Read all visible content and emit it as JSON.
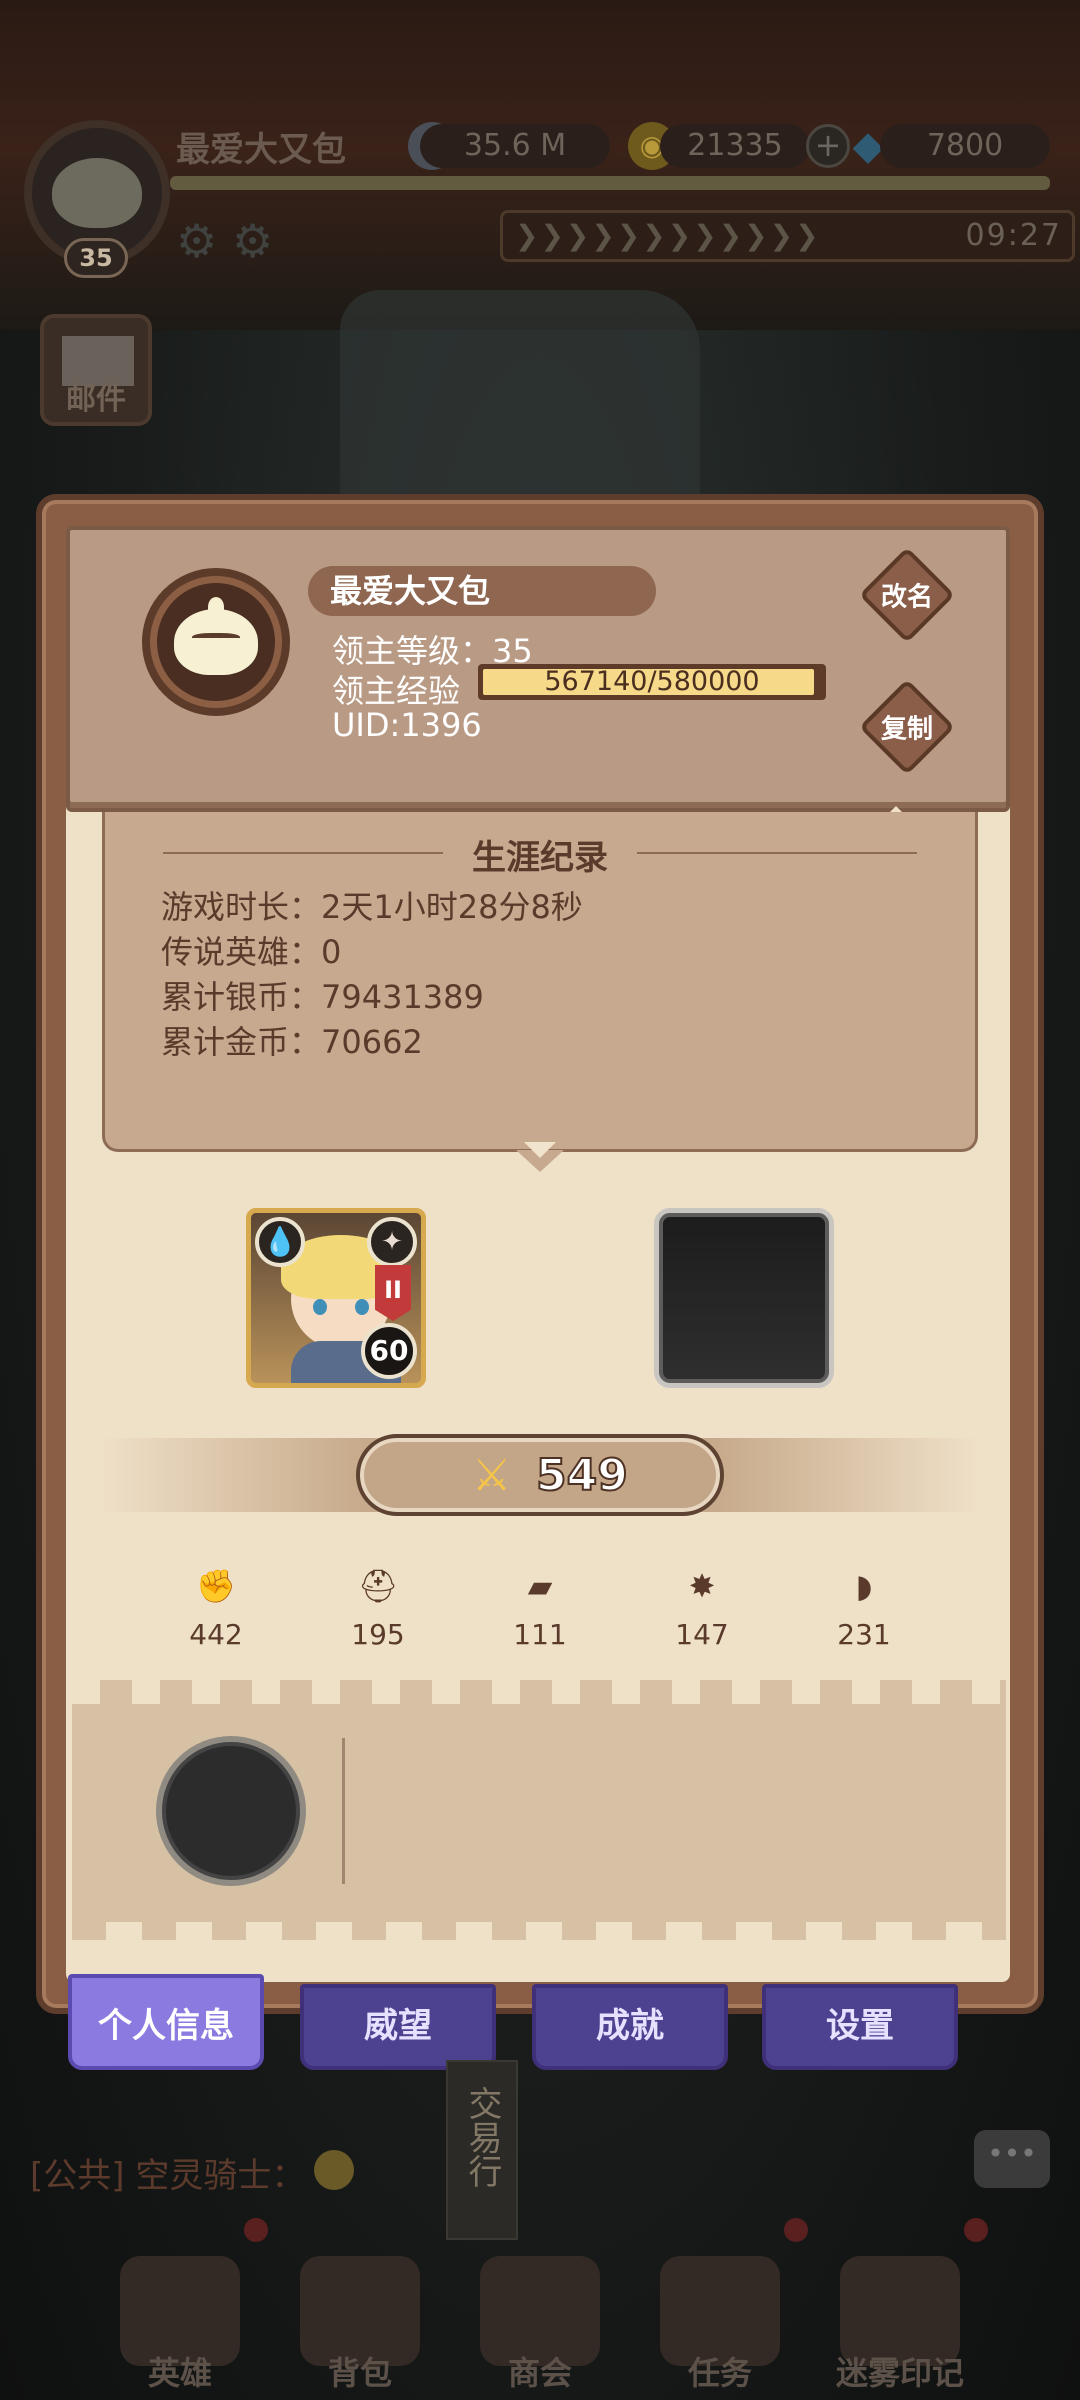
{
  "topbar": {
    "player_name": "最爱大又包",
    "player_level": "35",
    "silver": "35.6 M",
    "gold": "21335",
    "diamonds": "7800",
    "energy_timer": "09:27",
    "mail_label": "邮件"
  },
  "profile": {
    "name": "最爱大又包",
    "level_line": "领主等级：35",
    "exp_label": "领主经验",
    "exp_text": "567140/580000",
    "exp_progress": 0.978,
    "uid_line": "UID:1396",
    "rename_button": "改名",
    "copy_button": "复制"
  },
  "career": {
    "title": "生涯纪录",
    "rows": [
      "游戏时长：2天1小时28分8秒",
      "传说英雄：0",
      "累计银币：79431389",
      "累计金币：70662"
    ]
  },
  "hero_slot": {
    "level": "60",
    "rank": "II"
  },
  "power": {
    "value": "549"
  },
  "stats": [
    {
      "icon": "fist-icon",
      "value": "442"
    },
    {
      "icon": "helmet-icon",
      "value": "195"
    },
    {
      "icon": "boot-icon",
      "value": "111"
    },
    {
      "icon": "burst-icon",
      "value": "147"
    },
    {
      "icon": "arm-icon",
      "value": "231"
    }
  ],
  "tabs": [
    {
      "label": "个人信息",
      "active": true
    },
    {
      "label": "威望",
      "active": false
    },
    {
      "label": "成就",
      "active": false
    },
    {
      "label": "设置",
      "active": false
    }
  ],
  "background": {
    "trade_post": "交易行",
    "chat_line": "[公共] 空灵骑士：",
    "nav": [
      "英雄",
      "背包",
      "商会",
      "任务",
      "迷雾印记"
    ]
  },
  "colors": {
    "tab_active": "#8b7ae0",
    "tab_inactive": "#6b59b8",
    "panel_bg": "#efe0c8",
    "exp_fill": "#f7d98a"
  }
}
